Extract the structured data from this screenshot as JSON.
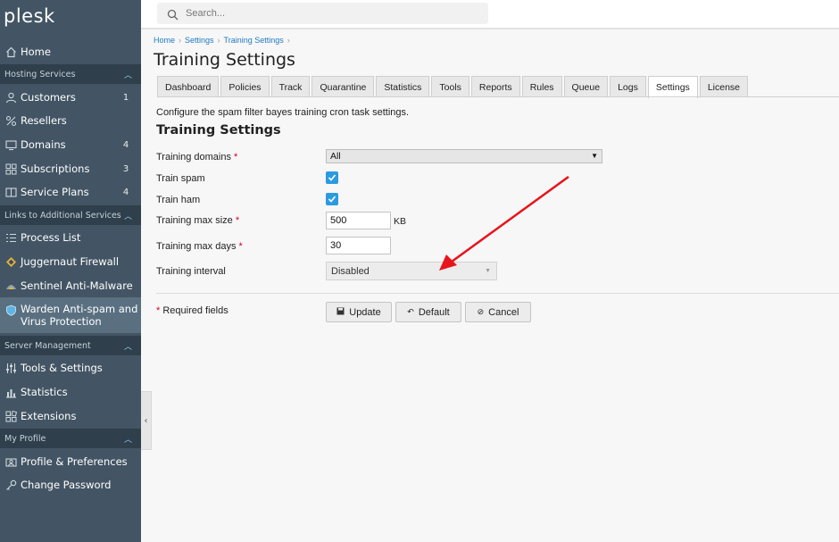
{
  "app": {
    "logo": "plesk"
  },
  "search": {
    "placeholder": "Search..."
  },
  "sidebar": {
    "home": {
      "label": "Home",
      "icon": "home-icon"
    },
    "sections": [
      {
        "title": "Hosting Services"
      },
      {
        "title": "Links to Additional Services"
      },
      {
        "title": "Server Management"
      },
      {
        "title": "My Profile"
      }
    ],
    "hosting": [
      {
        "label": "Customers",
        "count": "1",
        "icon": "user-icon"
      },
      {
        "label": "Resellers",
        "count": "",
        "icon": "percent-icon"
      },
      {
        "label": "Domains",
        "count": "4",
        "icon": "monitor-icon"
      },
      {
        "label": "Subscriptions",
        "count": "3",
        "icon": "grid-icon"
      },
      {
        "label": "Service Plans",
        "count": "4",
        "icon": "book-icon"
      }
    ],
    "links": [
      {
        "label": "Process List",
        "icon": "list-icon"
      },
      {
        "label": "Juggernaut Firewall",
        "icon": "firewall-icon"
      },
      {
        "label": "Sentinel Anti-Malware",
        "icon": "sentinel-icon"
      },
      {
        "label_line1": "Warden Anti-spam and",
        "label_line2": "Virus Protection",
        "icon": "shield-icon",
        "active": true
      }
    ],
    "server": [
      {
        "label": "Tools & Settings",
        "icon": "sliders-icon"
      },
      {
        "label": "Statistics",
        "icon": "bar-chart-icon"
      },
      {
        "label": "Extensions",
        "icon": "extensions-icon"
      }
    ],
    "profile": [
      {
        "label": "Profile & Preferences",
        "icon": "profile-icon"
      },
      {
        "label": "Change Password",
        "icon": "key-icon"
      }
    ]
  },
  "breadcrumb": [
    "Home",
    "Settings",
    "Training Settings"
  ],
  "page": {
    "title": "Training Settings"
  },
  "tabs": [
    "Dashboard",
    "Policies",
    "Track",
    "Quarantine",
    "Statistics",
    "Tools",
    "Reports",
    "Rules",
    "Queue",
    "Logs",
    "Settings",
    "License"
  ],
  "active_tab": "Settings",
  "form": {
    "description": "Configure the spam filter bayes training cron task settings.",
    "section_title": "Training Settings",
    "training_domains": {
      "label": "Training domains",
      "required": "*",
      "value": "All"
    },
    "train_spam": {
      "label": "Train spam",
      "checked": true
    },
    "train_ham": {
      "label": "Train ham",
      "checked": true
    },
    "max_size": {
      "label": "Training max size",
      "required": "*",
      "value": "500",
      "unit": "KB"
    },
    "max_days": {
      "label": "Training max days",
      "required": "*",
      "value": "30"
    },
    "interval": {
      "label": "Training interval",
      "value": "Disabled"
    },
    "required_note": "Required fields",
    "required_mark": "*",
    "buttons": {
      "update": "Update",
      "default": "Default",
      "cancel": "Cancel"
    }
  },
  "colors": {
    "sidebar": "#435564",
    "section": "#2f3f4c",
    "accent": "#2b9be0",
    "required": "#d0021b",
    "annotation_arrow": "#e8141c"
  }
}
